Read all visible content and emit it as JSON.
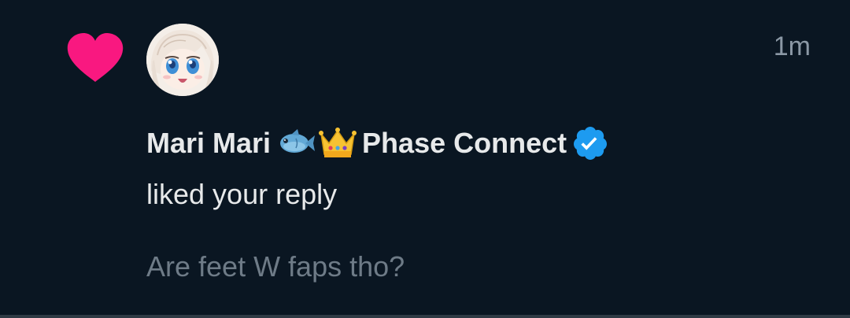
{
  "notification": {
    "type_icon": "heart-icon",
    "timestamp": "1m",
    "user": {
      "display_name_prefix": "Mari Mari",
      "emoji_1": "fish-emoji",
      "emoji_2": "crown-emoji",
      "display_name_suffix": "Phase Connect",
      "verified_icon": "verified-badge-icon",
      "avatar": "avatar-anime-character"
    },
    "action": "liked your reply",
    "reply_excerpt": "Are feet W faps tho?"
  },
  "colors": {
    "background": "#0a1622",
    "heart": "#f91880",
    "primary_text": "#e7e9ea",
    "secondary_text": "#6e7b87",
    "timestamp": "#8b98a5",
    "verified": "#1d9bf0"
  }
}
